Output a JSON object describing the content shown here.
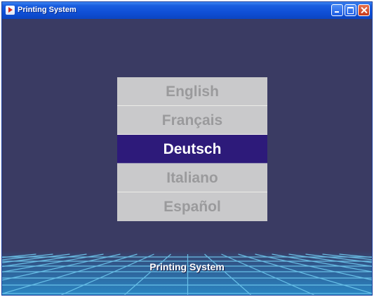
{
  "window": {
    "title": "Printing System"
  },
  "languages": [
    {
      "label": "English",
      "selected": false
    },
    {
      "label": "Français",
      "selected": false
    },
    {
      "label": "Deutsch",
      "selected": true
    },
    {
      "label": "Italiano",
      "selected": false
    },
    {
      "label": "Español",
      "selected": false
    }
  ],
  "footer": {
    "label": "Printing System"
  },
  "icons": {
    "app": "app-arrow-icon",
    "minimize": "minimize-icon",
    "maximize": "maximize-icon",
    "close": "close-icon"
  },
  "colors": {
    "background": "#3a3b63",
    "selected_item": "#2d1a7a",
    "menu_item": "#c9c9cb",
    "menu_text": "#9a9a9c",
    "floor_grid": "#4fb6e6"
  }
}
